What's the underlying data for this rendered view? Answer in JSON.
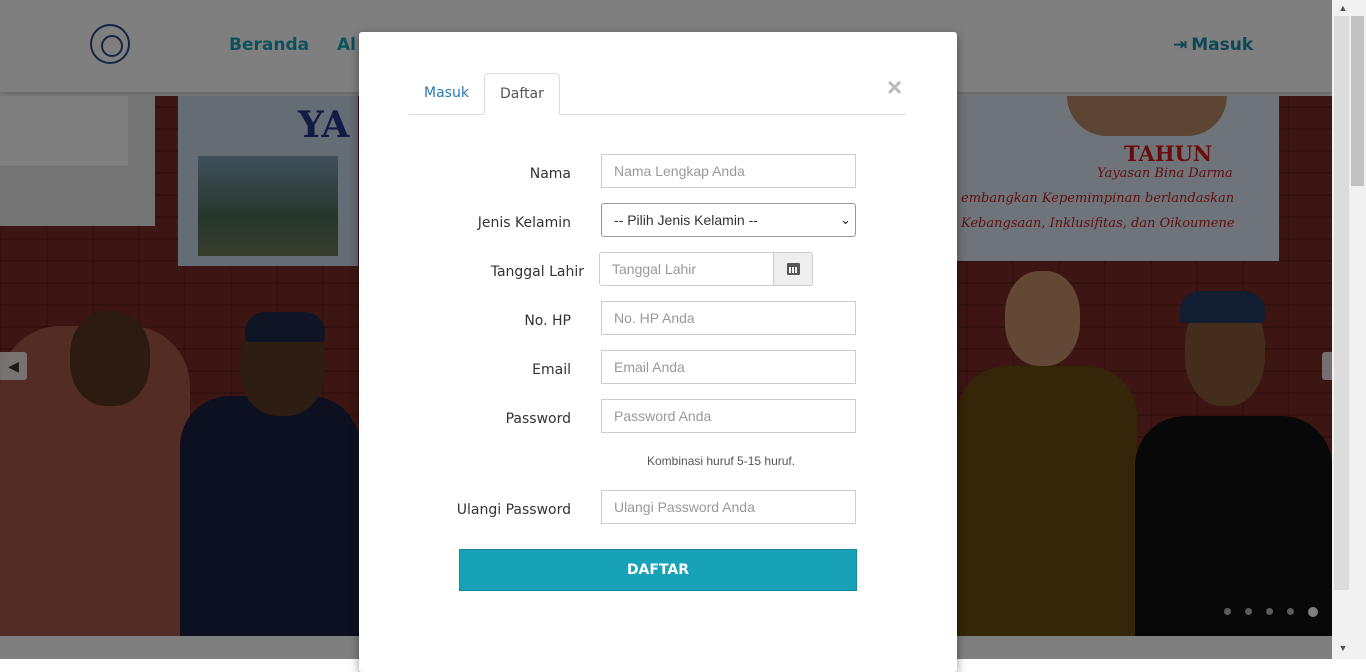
{
  "navbar": {
    "links": [
      "Beranda",
      "Al"
    ],
    "login_label": "Masuk",
    "login_icon": "sign-in-icon"
  },
  "banner": {
    "left_letters": "YA",
    "right_title": "TAHUN",
    "right_line1": "Yayasan Bina Darma",
    "right_line2": "embangkan Kepemimpinan berlandaskan",
    "right_line3": "Kebangsaan, Inklusifitas, dan Oikoumene"
  },
  "carousel": {
    "prev_icon": "chevron-left-icon",
    "dots": 5,
    "active_dot": 4
  },
  "modal": {
    "tabs": [
      {
        "label": "Masuk",
        "active": false
      },
      {
        "label": "Daftar",
        "active": true
      }
    ],
    "close_icon": "close-icon",
    "close_symbol": "×",
    "form": {
      "nama_label": "Nama",
      "nama_placeholder": "Nama Lengkap Anda",
      "gender_label": "Jenis Kelamin",
      "gender_selected": "-- Pilih Jenis Kelamin --",
      "dob_label": "Tanggal Lahir",
      "dob_placeholder": "Tanggal Lahir",
      "dob_icon": "calendar-icon",
      "hp_label": "No. HP",
      "hp_placeholder": "No. HP Anda",
      "email_label": "Email",
      "email_placeholder": "Email Anda",
      "password_label": "Password",
      "password_placeholder": "Password Anda",
      "password_hint": "Kombinasi huruf 5-15 huruf.",
      "repeat_label": "Ulangi Password",
      "repeat_placeholder": "Ulangi Password Anda",
      "submit_label": "DAFTAR"
    }
  },
  "colors": {
    "accent": "#17a2b8",
    "nav_text": "#1aa3bb",
    "tab_link": "#2a7ab0"
  }
}
